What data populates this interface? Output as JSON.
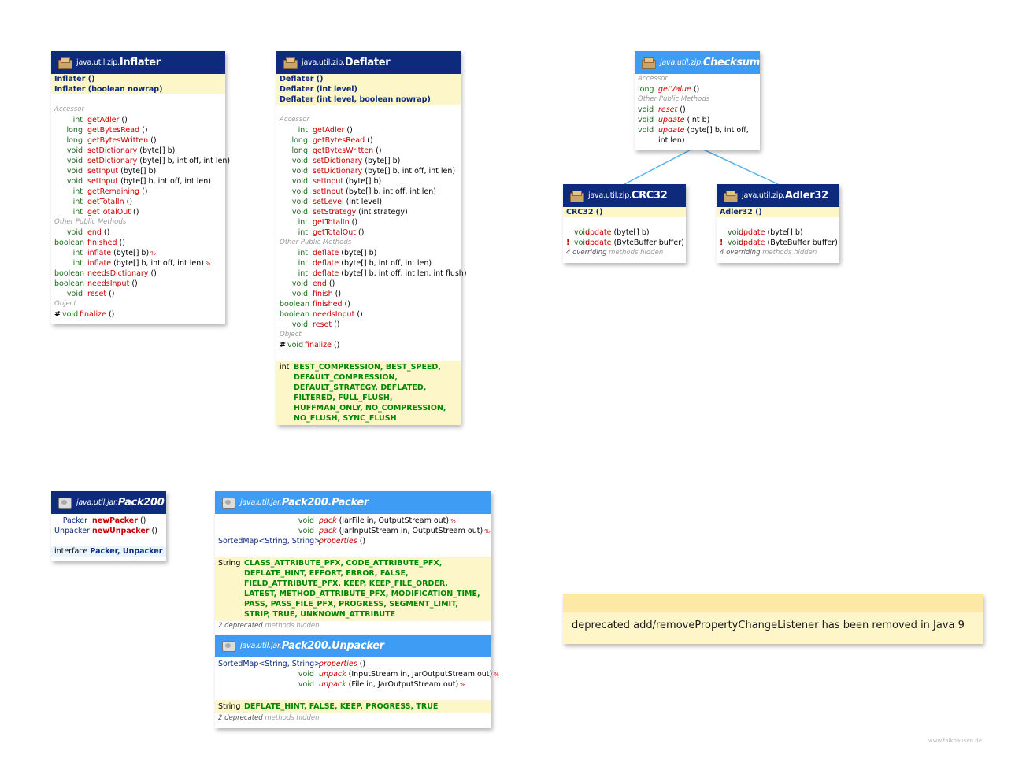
{
  "watermark": "www.falkhausen.de",
  "note": {
    "text": "deprecated  add/removePropertyChangeListener has been removed in Java 9"
  },
  "inflater": {
    "package": "java.util.zip.",
    "name": "Inflater",
    "ctors": [
      "Inflater ()",
      "Inflater (boolean nowrap)"
    ],
    "section_accessor": "Accessor",
    "section_other": "Other Public Methods",
    "section_object": "Object",
    "accessor": [
      {
        "type": "int",
        "name": "getAdler",
        "params": " ()"
      },
      {
        "type": "long",
        "name": "getBytesRead",
        "params": " ()"
      },
      {
        "type": "long",
        "name": "getBytesWritten",
        "params": " ()"
      },
      {
        "type": "void",
        "name": "setDictionary",
        "params": " (byte[] b)"
      },
      {
        "type": "void",
        "name": "setDictionary",
        "params": " (byte[] b, int off, int len)"
      },
      {
        "type": "void",
        "name": "setInput",
        "params": " (byte[] b)"
      },
      {
        "type": "void",
        "name": "setInput",
        "params": " (byte[] b, int off, int len)"
      },
      {
        "type": "int",
        "name": "getRemaining",
        "params": " ()"
      },
      {
        "type": "int",
        "name": "getTotalIn",
        "params": " ()"
      },
      {
        "type": "int",
        "name": "getTotalOut",
        "params": " ()"
      }
    ],
    "other": [
      {
        "type": "void",
        "name": "end",
        "params": " ()"
      },
      {
        "type": "boolean",
        "name": "finished",
        "params": " ()"
      },
      {
        "type": "int",
        "name": "inflate",
        "params": " (byte[] b)",
        "mark": "%"
      },
      {
        "type": "int",
        "name": "inflate",
        "params": " (byte[] b, int off, int len)",
        "mark": "%"
      },
      {
        "type": "boolean",
        "name": "needsDictionary",
        "params": " ()"
      },
      {
        "type": "boolean",
        "name": "needsInput",
        "params": " ()"
      },
      {
        "type": "void",
        "name": "reset",
        "params": " ()"
      }
    ],
    "object": [
      {
        "mod": "#",
        "type": "void",
        "name": "finalize",
        "params": " ()"
      }
    ]
  },
  "deflater": {
    "package": "java.util.zip.",
    "name": "Deflater",
    "ctors": [
      "Deflater ()",
      "Deflater (int level)",
      "Deflater (int level, boolean nowrap)"
    ],
    "section_accessor": "Accessor",
    "section_other": "Other Public Methods",
    "section_object": "Object",
    "accessor": [
      {
        "type": "int",
        "name": "getAdler",
        "params": " ()"
      },
      {
        "type": "long",
        "name": "getBytesRead",
        "params": " ()"
      },
      {
        "type": "long",
        "name": "getBytesWritten",
        "params": " ()"
      },
      {
        "type": "void",
        "name": "setDictionary",
        "params": " (byte[] b)"
      },
      {
        "type": "void",
        "name": "setDictionary",
        "params": " (byte[] b, int off, int len)"
      },
      {
        "type": "void",
        "name": "setInput",
        "params": " (byte[] b)"
      },
      {
        "type": "void",
        "name": "setInput",
        "params": " (byte[] b, int off, int len)"
      },
      {
        "type": "void",
        "name": "setLevel",
        "params": " (int level)"
      },
      {
        "type": "void",
        "name": "setStrategy",
        "params": " (int strategy)"
      },
      {
        "type": "int",
        "name": "getTotalIn",
        "params": " ()"
      },
      {
        "type": "int",
        "name": "getTotalOut",
        "params": " ()"
      }
    ],
    "other": [
      {
        "type": "int",
        "name": "deflate",
        "params": " (byte[] b)"
      },
      {
        "type": "int",
        "name": "deflate",
        "params": " (byte[] b, int off, int len)"
      },
      {
        "type": "int",
        "name": "deflate",
        "params": " (byte[] b, int off, int len, int flush)"
      },
      {
        "type": "void",
        "name": "end",
        "params": " ()"
      },
      {
        "type": "void",
        "name": "finish",
        "params": " ()"
      },
      {
        "type": "boolean",
        "name": "finished",
        "params": " ()"
      },
      {
        "type": "boolean",
        "name": "needsInput",
        "params": " ()"
      },
      {
        "type": "void",
        "name": "reset",
        "params": " ()"
      }
    ],
    "object": [
      {
        "mod": "#",
        "type": "void",
        "name": "finalize",
        "params": " ()"
      }
    ],
    "const_type": "int",
    "constants": "BEST_COMPRESSION, BEST_SPEED, DEFAULT_COMPRESSION, DEFAULT_STRATEGY, DEFLATED, FILTERED, FULL_FLUSH, HUFFMAN_ONLY, NO_COMPRESSION, NO_FLUSH, SYNC_FLUSH"
  },
  "checksum": {
    "package": "java.util.zip.",
    "name": "Checksum",
    "section_accessor": "Accessor",
    "section_other": "Other Public Methods",
    "accessor": [
      {
        "type": "long",
        "name": "getValue",
        "params": " ()"
      }
    ],
    "other": [
      {
        "type": "void",
        "name": "reset",
        "params": " ()"
      },
      {
        "type": "void",
        "name": "update",
        "params": " (int b)"
      },
      {
        "type": "void",
        "name": "update",
        "params": " (byte[] b, int off,"
      },
      {
        "type": "",
        "name": "",
        "params": "int len)"
      }
    ]
  },
  "crc32": {
    "package": "java.util.zip.",
    "name": "CRC32",
    "ctors": [
      "CRC32 ()"
    ],
    "methods": [
      {
        "mod": "",
        "type": "void",
        "name": "update",
        "params": " (byte[] b)"
      },
      {
        "mod": "!",
        "type": "void",
        "name": "update",
        "params": " (ByteBuffer buffer)"
      }
    ],
    "hidden_count": "4 overriding",
    "hidden_label": "methods hidden"
  },
  "adler32": {
    "package": "java.util.zip.",
    "name": "Adler32",
    "ctors": [
      "Adler32 ()"
    ],
    "methods": [
      {
        "mod": "",
        "type": "void",
        "name": "update",
        "params": " (byte[] b)"
      },
      {
        "mod": "!",
        "type": "void",
        "name": "update",
        "params": " (ByteBuffer buffer)"
      }
    ],
    "hidden_count": "4 overriding",
    "hidden_label": "methods hidden"
  },
  "pack200": {
    "package": "java.util.jar.",
    "name": "Pack200",
    "methods": [
      {
        "type": "Packer",
        "name": "newPacker",
        "params": " ()"
      },
      {
        "type": "Unpacker",
        "name": "newUnpacker",
        "params": " ()"
      }
    ],
    "interfaces_label": "interface",
    "interfaces": "Packer, Unpacker"
  },
  "packer": {
    "package": "java.util.jar.",
    "name": "Pack200.Packer",
    "methods": [
      {
        "type": "void",
        "name": "pack",
        "params": " (JarFile in, OutputStream out)",
        "mark": "%"
      },
      {
        "type": "void",
        "name": "pack",
        "params": " (JarInputStream in, OutputStream out)",
        "mark": "%"
      },
      {
        "type": "SortedMap<String, String>",
        "name": "properties",
        "params": " ()"
      }
    ],
    "const_type": "String",
    "constants": "CLASS_ATTRIBUTE_PFX, CODE_ATTRIBUTE_PFX, DEFLATE_HINT, EFFORT, ERROR, FALSE, FIELD_ATTRIBUTE_PFX, KEEP, KEEP_FILE_ORDER, LATEST, METHOD_ATTRIBUTE_PFX, MODIFICATION_TIME, PASS, PASS_FILE_PFX, PROGRESS, SEGMENT_LIMIT, STRIP, TRUE, UNKNOWN_ATTRIBUTE",
    "hidden_count": "2 deprecated",
    "hidden_label": "methods hidden"
  },
  "unpacker": {
    "package": "java.util.jar.",
    "name": "Pack200.Unpacker",
    "methods": [
      {
        "type": "SortedMap<String, String>",
        "name": "properties",
        "params": " ()"
      },
      {
        "type": "void",
        "name": "unpack",
        "params": " (InputStream in, JarOutputStream out)",
        "mark": "%"
      },
      {
        "type": "void",
        "name": "unpack",
        "params": " (File in, JarOutputStream out)",
        "mark": "%"
      }
    ],
    "const_type": "String",
    "constants": "DEFLATE_HINT, FALSE, KEEP, PROGRESS, TRUE",
    "hidden_count": "2 deprecated",
    "hidden_label": "methods hidden"
  }
}
